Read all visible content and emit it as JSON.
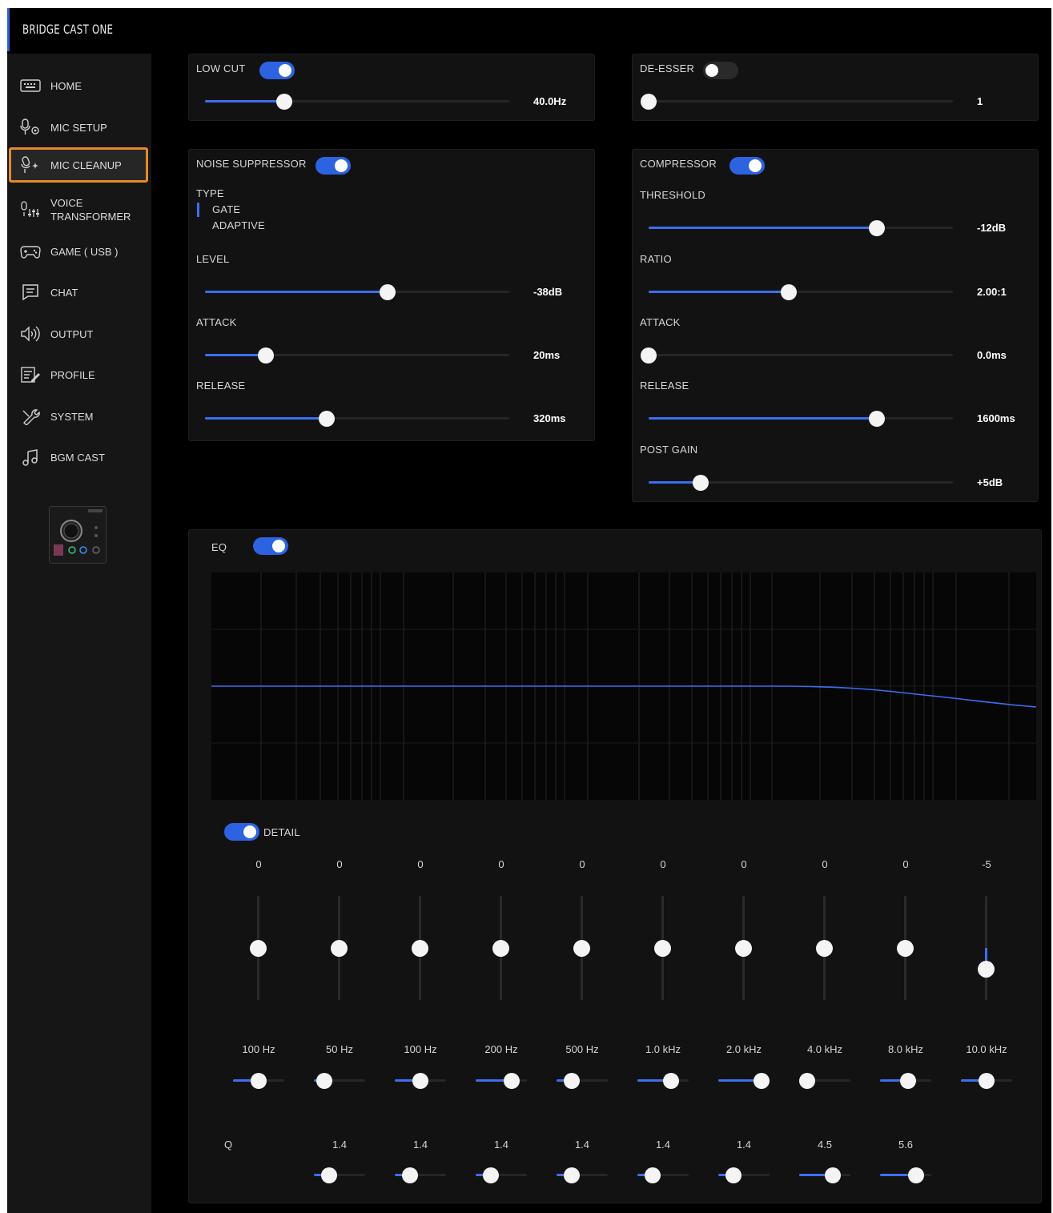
{
  "app": {
    "title": "BRIDGE CAST ONE"
  },
  "sidebar": {
    "items": [
      {
        "label": "HOME",
        "icon": "keyboard-icon"
      },
      {
        "label": "MIC SETUP",
        "icon": "mic-gear-icon"
      },
      {
        "label": "MIC CLEANUP",
        "icon": "mic-sparkle-icon",
        "active": true
      },
      {
        "label": "VOICE\nTRANSFORMER",
        "icon": "mic-sliders-icon"
      },
      {
        "label": "GAME ( USB )",
        "icon": "gamepad-icon"
      },
      {
        "label": "CHAT",
        "icon": "chat-icon"
      },
      {
        "label": "OUTPUT",
        "icon": "speaker-icon"
      },
      {
        "label": "PROFILE",
        "icon": "profile-edit-icon"
      },
      {
        "label": "SYSTEM",
        "icon": "wrench-icon"
      },
      {
        "label": "BGM CAST",
        "icon": "music-note-icon"
      }
    ]
  },
  "low_cut": {
    "label": "LOW CUT",
    "enabled": true,
    "value": "40.0Hz",
    "level": 0.26
  },
  "de_esser": {
    "label": "DE-ESSER",
    "enabled": false,
    "value": "1",
    "level": 0.0
  },
  "noise_suppressor": {
    "label": "NOISE SUPPRESSOR",
    "enabled": true,
    "type_label": "TYPE",
    "type_options": [
      "GATE",
      "ADAPTIVE"
    ],
    "type_selected": "GATE",
    "level": {
      "label": "LEVEL",
      "value": "-38dB",
      "level": 0.6
    },
    "attack": {
      "label": "ATTACK",
      "value": "20ms",
      "level": 0.2
    },
    "release": {
      "label": "RELEASE",
      "value": "320ms",
      "level": 0.4
    }
  },
  "compressor": {
    "label": "COMPRESSOR",
    "enabled": true,
    "threshold": {
      "label": "THRESHOLD",
      "value": "-12dB",
      "level": 0.75
    },
    "ratio": {
      "label": "RATIO",
      "value": "2.00:1",
      "level": 0.46
    },
    "attack": {
      "label": "ATTACK",
      "value": "0.0ms",
      "level": 0.0
    },
    "release": {
      "label": "RELEASE",
      "value": "1600ms",
      "level": 0.75
    },
    "post_gain": {
      "label": "POST GAIN",
      "value": "+5dB",
      "level": 0.17
    }
  },
  "eq": {
    "label": "EQ",
    "enabled": true,
    "detail_label": "DETAIL",
    "detail_enabled": true,
    "q_label": "Q",
    "bands": [
      {
        "gain": "0",
        "gain_level": 0.5,
        "freq": "100 Hz",
        "freq_level": 0.5,
        "q": null,
        "q_level": null
      },
      {
        "gain": "0",
        "gain_level": 0.5,
        "freq": "50 Hz",
        "freq_level": 0.2,
        "q": "1.4",
        "q_level": 0.3
      },
      {
        "gain": "0",
        "gain_level": 0.5,
        "freq": "100 Hz",
        "freq_level": 0.5,
        "q": "1.4",
        "q_level": 0.3
      },
      {
        "gain": "0",
        "gain_level": 0.5,
        "freq": "200 Hz",
        "freq_level": 0.7,
        "q": "1.4",
        "q_level": 0.3
      },
      {
        "gain": "0",
        "gain_level": 0.5,
        "freq": "500 Hz",
        "freq_level": 0.3,
        "q": "1.4",
        "q_level": 0.3
      },
      {
        "gain": "0",
        "gain_level": 0.5,
        "freq": "1.0 kHz",
        "freq_level": 0.65,
        "q": "1.4",
        "q_level": 0.3
      },
      {
        "gain": "0",
        "gain_level": 0.5,
        "freq": "2.0 kHz",
        "freq_level": 0.85,
        "q": "1.4",
        "q_level": 0.3
      },
      {
        "gain": "0",
        "gain_level": 0.5,
        "freq": "4.0 kHz",
        "freq_level": 0.15,
        "q": "4.5",
        "q_level": 0.65
      },
      {
        "gain": "0",
        "gain_level": 0.5,
        "freq": "8.0 kHz",
        "freq_level": 0.55,
        "q": "5.6",
        "q_level": 0.7
      },
      {
        "gain": "-5",
        "gain_level": 0.3,
        "freq": "10.0 kHz",
        "freq_level": 0.5,
        "q": null,
        "q_level": null
      }
    ]
  },
  "colors": {
    "accent": "#3c6ef0",
    "active_outline": "#e58a2a",
    "panel": "#121212"
  }
}
